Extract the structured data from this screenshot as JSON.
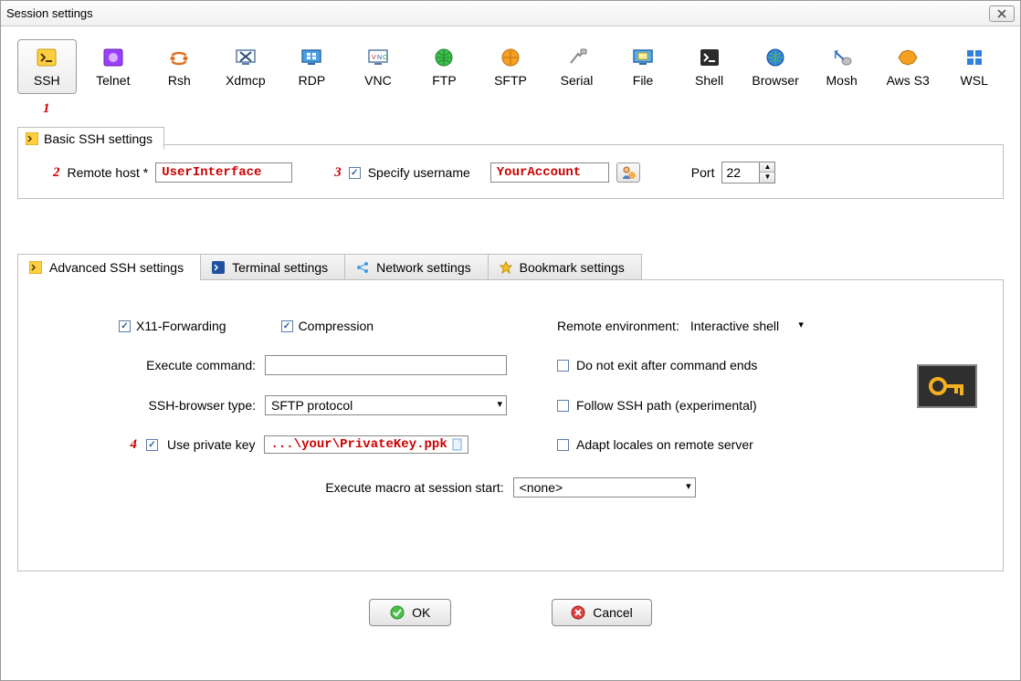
{
  "window": {
    "title": "Session settings"
  },
  "annotations": {
    "n1": "1",
    "n2": "2",
    "n3": "3",
    "n4": "4"
  },
  "session_types": [
    {
      "id": "ssh",
      "label": "SSH"
    },
    {
      "id": "telnet",
      "label": "Telnet"
    },
    {
      "id": "rsh",
      "label": "Rsh"
    },
    {
      "id": "xdmcp",
      "label": "Xdmcp"
    },
    {
      "id": "rdp",
      "label": "RDP"
    },
    {
      "id": "vnc",
      "label": "VNC"
    },
    {
      "id": "ftp",
      "label": "FTP"
    },
    {
      "id": "sftp",
      "label": "SFTP"
    },
    {
      "id": "serial",
      "label": "Serial"
    },
    {
      "id": "file",
      "label": "File"
    },
    {
      "id": "shell",
      "label": "Shell"
    },
    {
      "id": "browser",
      "label": "Browser"
    },
    {
      "id": "mosh",
      "label": "Mosh"
    },
    {
      "id": "awss3",
      "label": "Aws S3"
    },
    {
      "id": "wsl",
      "label": "WSL"
    }
  ],
  "basic": {
    "tab_label": "Basic SSH settings",
    "remote_host_label": "Remote host *",
    "remote_host_value": "UserInterface",
    "specify_username_label": "Specify username",
    "specify_username_checked": true,
    "username_value": "YourAccount",
    "port_label": "Port",
    "port_value": "22"
  },
  "adv_tabs": {
    "advanced": "Advanced SSH settings",
    "terminal": "Terminal settings",
    "network": "Network settings",
    "bookmark": "Bookmark settings"
  },
  "advanced": {
    "x11_label": "X11-Forwarding",
    "x11_checked": true,
    "compression_label": "Compression",
    "compression_checked": true,
    "remote_env_label": "Remote environment:",
    "remote_env_value": "Interactive shell",
    "exec_cmd_label": "Execute command:",
    "exec_cmd_value": "",
    "do_not_exit_label": "Do not exit after command ends",
    "do_not_exit_checked": false,
    "ssh_browser_label": "SSH-browser type:",
    "ssh_browser_value": "SFTP protocol",
    "follow_path_label": "Follow SSH path (experimental)",
    "follow_path_checked": false,
    "use_private_key_label": "Use private key",
    "use_private_key_checked": true,
    "private_key_value": "...\\your\\PrivateKey.ppk",
    "adapt_locales_label": "Adapt locales on remote server",
    "adapt_locales_checked": false,
    "macro_label": "Execute macro at session start:",
    "macro_value": "<none>"
  },
  "buttons": {
    "ok": "OK",
    "cancel": "Cancel"
  }
}
